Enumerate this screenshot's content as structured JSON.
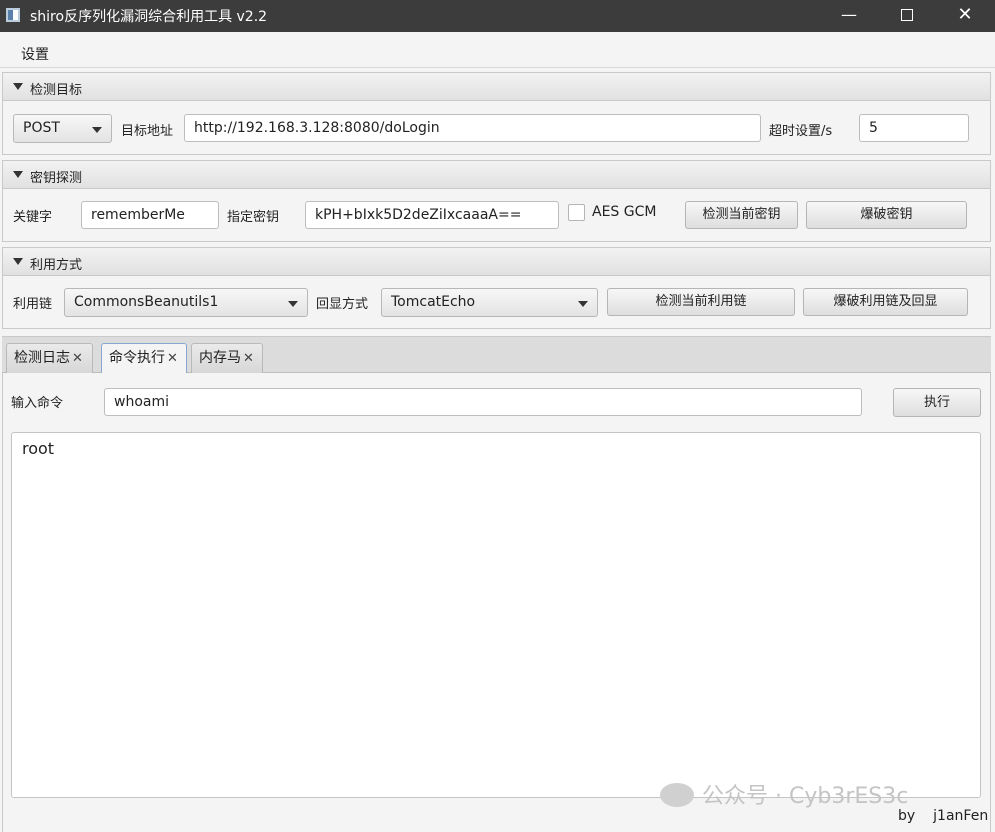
{
  "window": {
    "title": "shiro反序列化漏洞综合利用工具 v2.2",
    "minimize": "—",
    "close": "✕"
  },
  "menu": {
    "settings": "设置"
  },
  "target_panel": {
    "title": "检测目标",
    "method": "POST",
    "url_label": "目标地址",
    "url_value": "http://192.168.3.128:8080/doLogin",
    "timeout_label": "超时设置/s",
    "timeout_value": "5"
  },
  "key_panel": {
    "title": "密钥探测",
    "keyword_label": "关键字",
    "keyword_value": "rememberMe",
    "key_label": "指定密钥",
    "key_value": "kPH+bIxk5D2deZiIxcaaaA==",
    "aes_gcm_label": "AES GCM",
    "aes_gcm_checked": false,
    "check_key_button": "检测当前密钥",
    "brute_key_button": "爆破密钥"
  },
  "exploit_panel": {
    "title": "利用方式",
    "chain_label": "利用链",
    "chain_value": "CommonsBeanutils1",
    "echo_label": "回显方式",
    "echo_value": "TomcatEcho",
    "check_chain_button": "检测当前利用链",
    "brute_chain_button": "爆破利用链及回显"
  },
  "tabs": [
    {
      "label": "检测日志",
      "close": "✕",
      "active": false
    },
    {
      "label": "命令执行",
      "close": "✕",
      "active": true
    },
    {
      "label": "内存马",
      "close": "✕",
      "active": false
    }
  ],
  "command": {
    "input_label": "输入命令",
    "input_value": "whoami",
    "execute_button": "执行",
    "output": "root"
  },
  "watermark": "公众号 · Cyb3rES3c",
  "footer": {
    "by": "by",
    "author": "j1anFen"
  }
}
